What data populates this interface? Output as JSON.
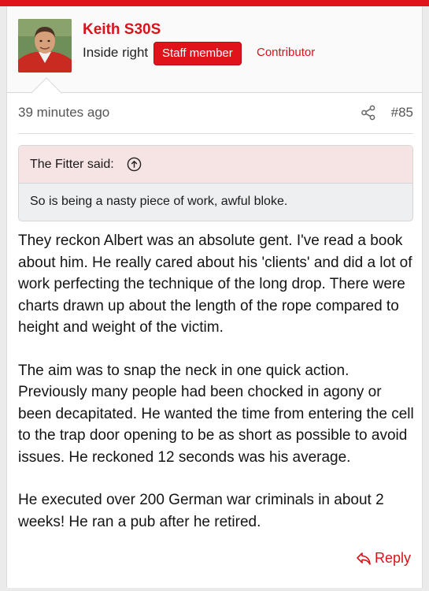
{
  "theme": {
    "accent": "#e0131a",
    "quote_header_bg": "#f6e3e4"
  },
  "user": {
    "name": "Keith S30S",
    "title": "Inside right",
    "badges": [
      "Staff member",
      "Contributor"
    ]
  },
  "meta": {
    "time": "39 minutes ago",
    "share_icon": "share-icon",
    "post_number": "#85"
  },
  "quote": {
    "author": "The Fitter said:",
    "expand_icon": "arrow-up-circle-icon",
    "text": "So is being a nasty piece of work, awful bloke."
  },
  "body": {
    "paragraphs": [
      "They reckon Albert was an absolute gent. I've read a book about him. He really cared about his 'clients' and did a lot of work perfecting the technique of the long drop. There were charts drawn up about the length of the rope compared to height and weight of the victim.",
      "The aim was to snap the neck in one quick action. Previously many people had been chocked in agony or been decapitated. He wanted the time from entering the cell to the trap door opening to be as short as possible to avoid issues. He reckoned 12 seconds was his average.",
      "He executed over 200 German war criminals in about 2 weeks! He ran a pub after he retired."
    ]
  },
  "actions": {
    "reply_label": "Reply",
    "reply_icon": "reply-icon"
  }
}
